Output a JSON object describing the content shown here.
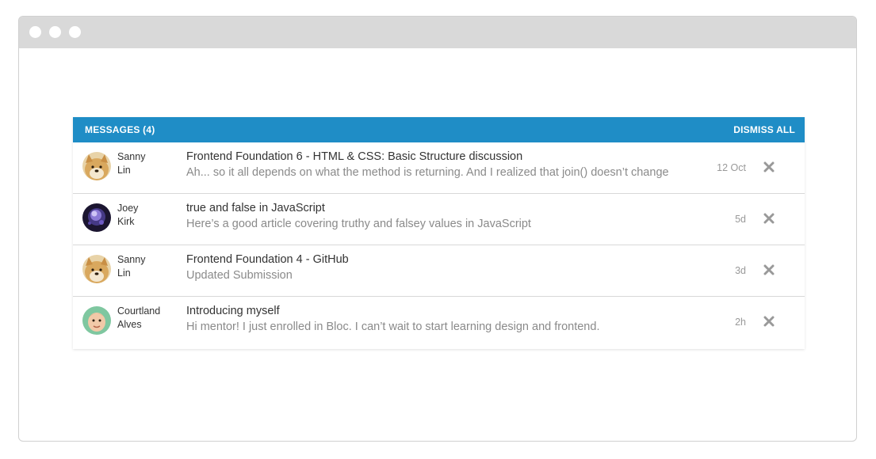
{
  "header": {
    "title": "MESSAGES (4)",
    "dismiss_all": "DISMISS ALL"
  },
  "colors": {
    "accent": "#1f8dc6",
    "titlebar": "#d9d9d9"
  },
  "messages": [
    {
      "first_name": "Sanny",
      "last_name": "Lin",
      "avatar_icon": "doge-avatar",
      "subject": "Frontend Foundation 6 - HTML & CSS: Basic Structure discussion",
      "preview": "Ah... so it all depends on what the method is returning. And I realized that join() doesn’t change",
      "time": "12 Oct"
    },
    {
      "first_name": "Joey",
      "last_name": "Kirk",
      "avatar_icon": "nebula-avatar",
      "subject": "true and false in JavaScript",
      "preview": "Here’s a good article covering truthy and falsey values in JavaScript",
      "time": "5d"
    },
    {
      "first_name": "Sanny",
      "last_name": "Lin",
      "avatar_icon": "doge-avatar",
      "subject": "Frontend Foundation 4 - GitHub",
      "preview": "Updated Submission",
      "time": "3d"
    },
    {
      "first_name": "Courtland",
      "last_name": "Alves",
      "avatar_icon": "baby-avatar",
      "subject": "Introducing myself",
      "preview": "Hi mentor! I just enrolled in Bloc. I can’t wait to start learning design and frontend.",
      "time": "2h"
    }
  ]
}
